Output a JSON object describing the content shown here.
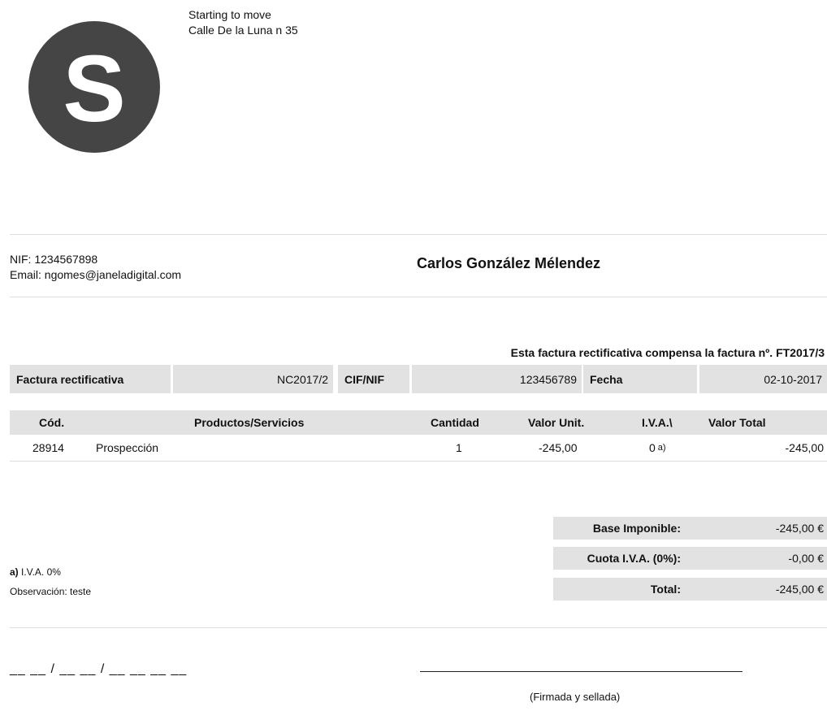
{
  "company": {
    "logo_letter": "S",
    "name": "Starting to move",
    "address": "Calle De la Luna n 35"
  },
  "client": {
    "nif_line": "NIF: 1234567898",
    "email_line": "Email: ngomes@janeladigital.com",
    "name": "Carlos González Mélendez"
  },
  "compensation_note": "Esta factura rectificativa compensa la factura nº. FT2017/3",
  "info": {
    "invoice_label": "Factura rectificativa",
    "invoice_value": "NC2017/2",
    "cif_label": "CIF/NIF",
    "cif_value": "123456789",
    "date_label": "Fecha",
    "date_value": "02-10-2017"
  },
  "items": {
    "headers": {
      "code": "Cód.",
      "product": "Productos/Servicios",
      "qty": "Cantidad",
      "unit": "Valor Unit.",
      "vat": "I.V.A.\\",
      "total": "Valor Total"
    },
    "rows": [
      {
        "code": "28914",
        "product": "Prospección",
        "qty": "1",
        "unit": "-245,00",
        "vat": "0",
        "vat_note": "a)",
        "total": "-245,00"
      }
    ]
  },
  "totals": {
    "base_label": "Base Imponible:",
    "base_value": "-245,00 €",
    "vat_label": "Cuota I.V.A. (0%):",
    "vat_value": "-0,00 €",
    "total_label": "Total:",
    "total_value": "-245,00 €"
  },
  "notes": {
    "vat_note_mark": "a)",
    "vat_note_text": " I.V.A. 0%",
    "observation": "Observación: teste"
  },
  "signature": {
    "date_placeholder": "__ __ / __ __ / __ __ __ __",
    "caption": "(Firmada y sellada)"
  }
}
